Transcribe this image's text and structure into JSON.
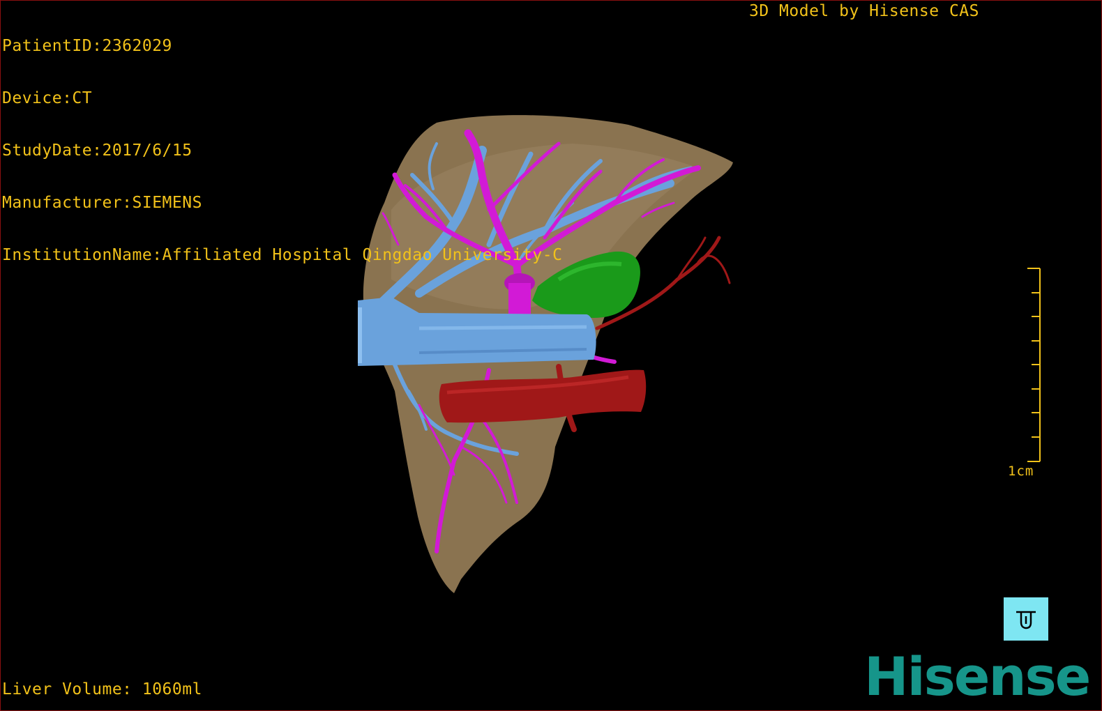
{
  "info": {
    "patient_id": "PatientID:2362029",
    "device": "Device:CT",
    "study_date": "StudyDate:2017/6/15",
    "manufacturer": "Manufacturer:SIEMENS",
    "institution": "InstitutionName:Affiliated Hospital Qingdao University-C"
  },
  "title": "3D Model by Hisense CAS",
  "liver_volume": "Liver Volume: 1060ml",
  "scale": {
    "label": "1cm"
  },
  "logo": "Hisense",
  "colors": {
    "text": "#f2c21a",
    "liver": "#8a7350",
    "portal_vein": "#d21ad6",
    "hepatic_vein": "#6aa2dc",
    "tumor": "#1a9a1a",
    "artery": "#a01818",
    "orientation_button": "#7ee6f2",
    "logo": "#16958a"
  },
  "icons": {
    "orientation": "orientation-cube-icon"
  }
}
